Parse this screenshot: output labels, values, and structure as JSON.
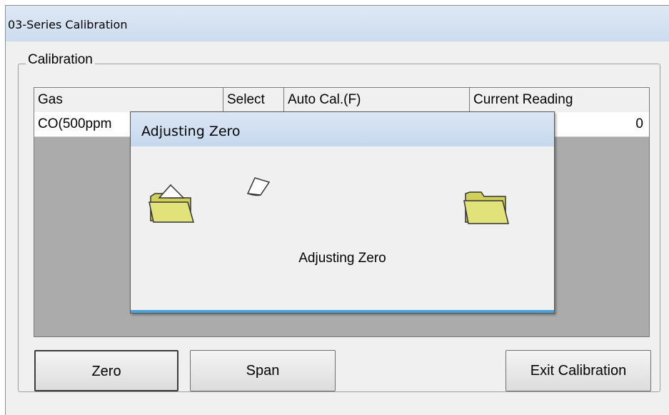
{
  "window": {
    "title": "03-Series Calibration"
  },
  "calibration_group": {
    "label": "Calibration"
  },
  "grid": {
    "columns": [
      "Gas",
      "Select",
      "Auto Cal.(F)",
      "Current Reading"
    ],
    "rows": [
      {
        "gas": "CO(500ppm",
        "select": "",
        "auto_cal": "",
        "current_reading": "0"
      }
    ]
  },
  "buttons": {
    "zero": "Zero",
    "span": "Span",
    "exit": "Exit Calibration"
  },
  "dialog": {
    "title": "Adjusting Zero",
    "message": "Adjusting Zero"
  },
  "colors": {
    "folder": "#e2e27a",
    "dialog_accent": "#4aa3d8",
    "grid_bg": "#ababab"
  }
}
